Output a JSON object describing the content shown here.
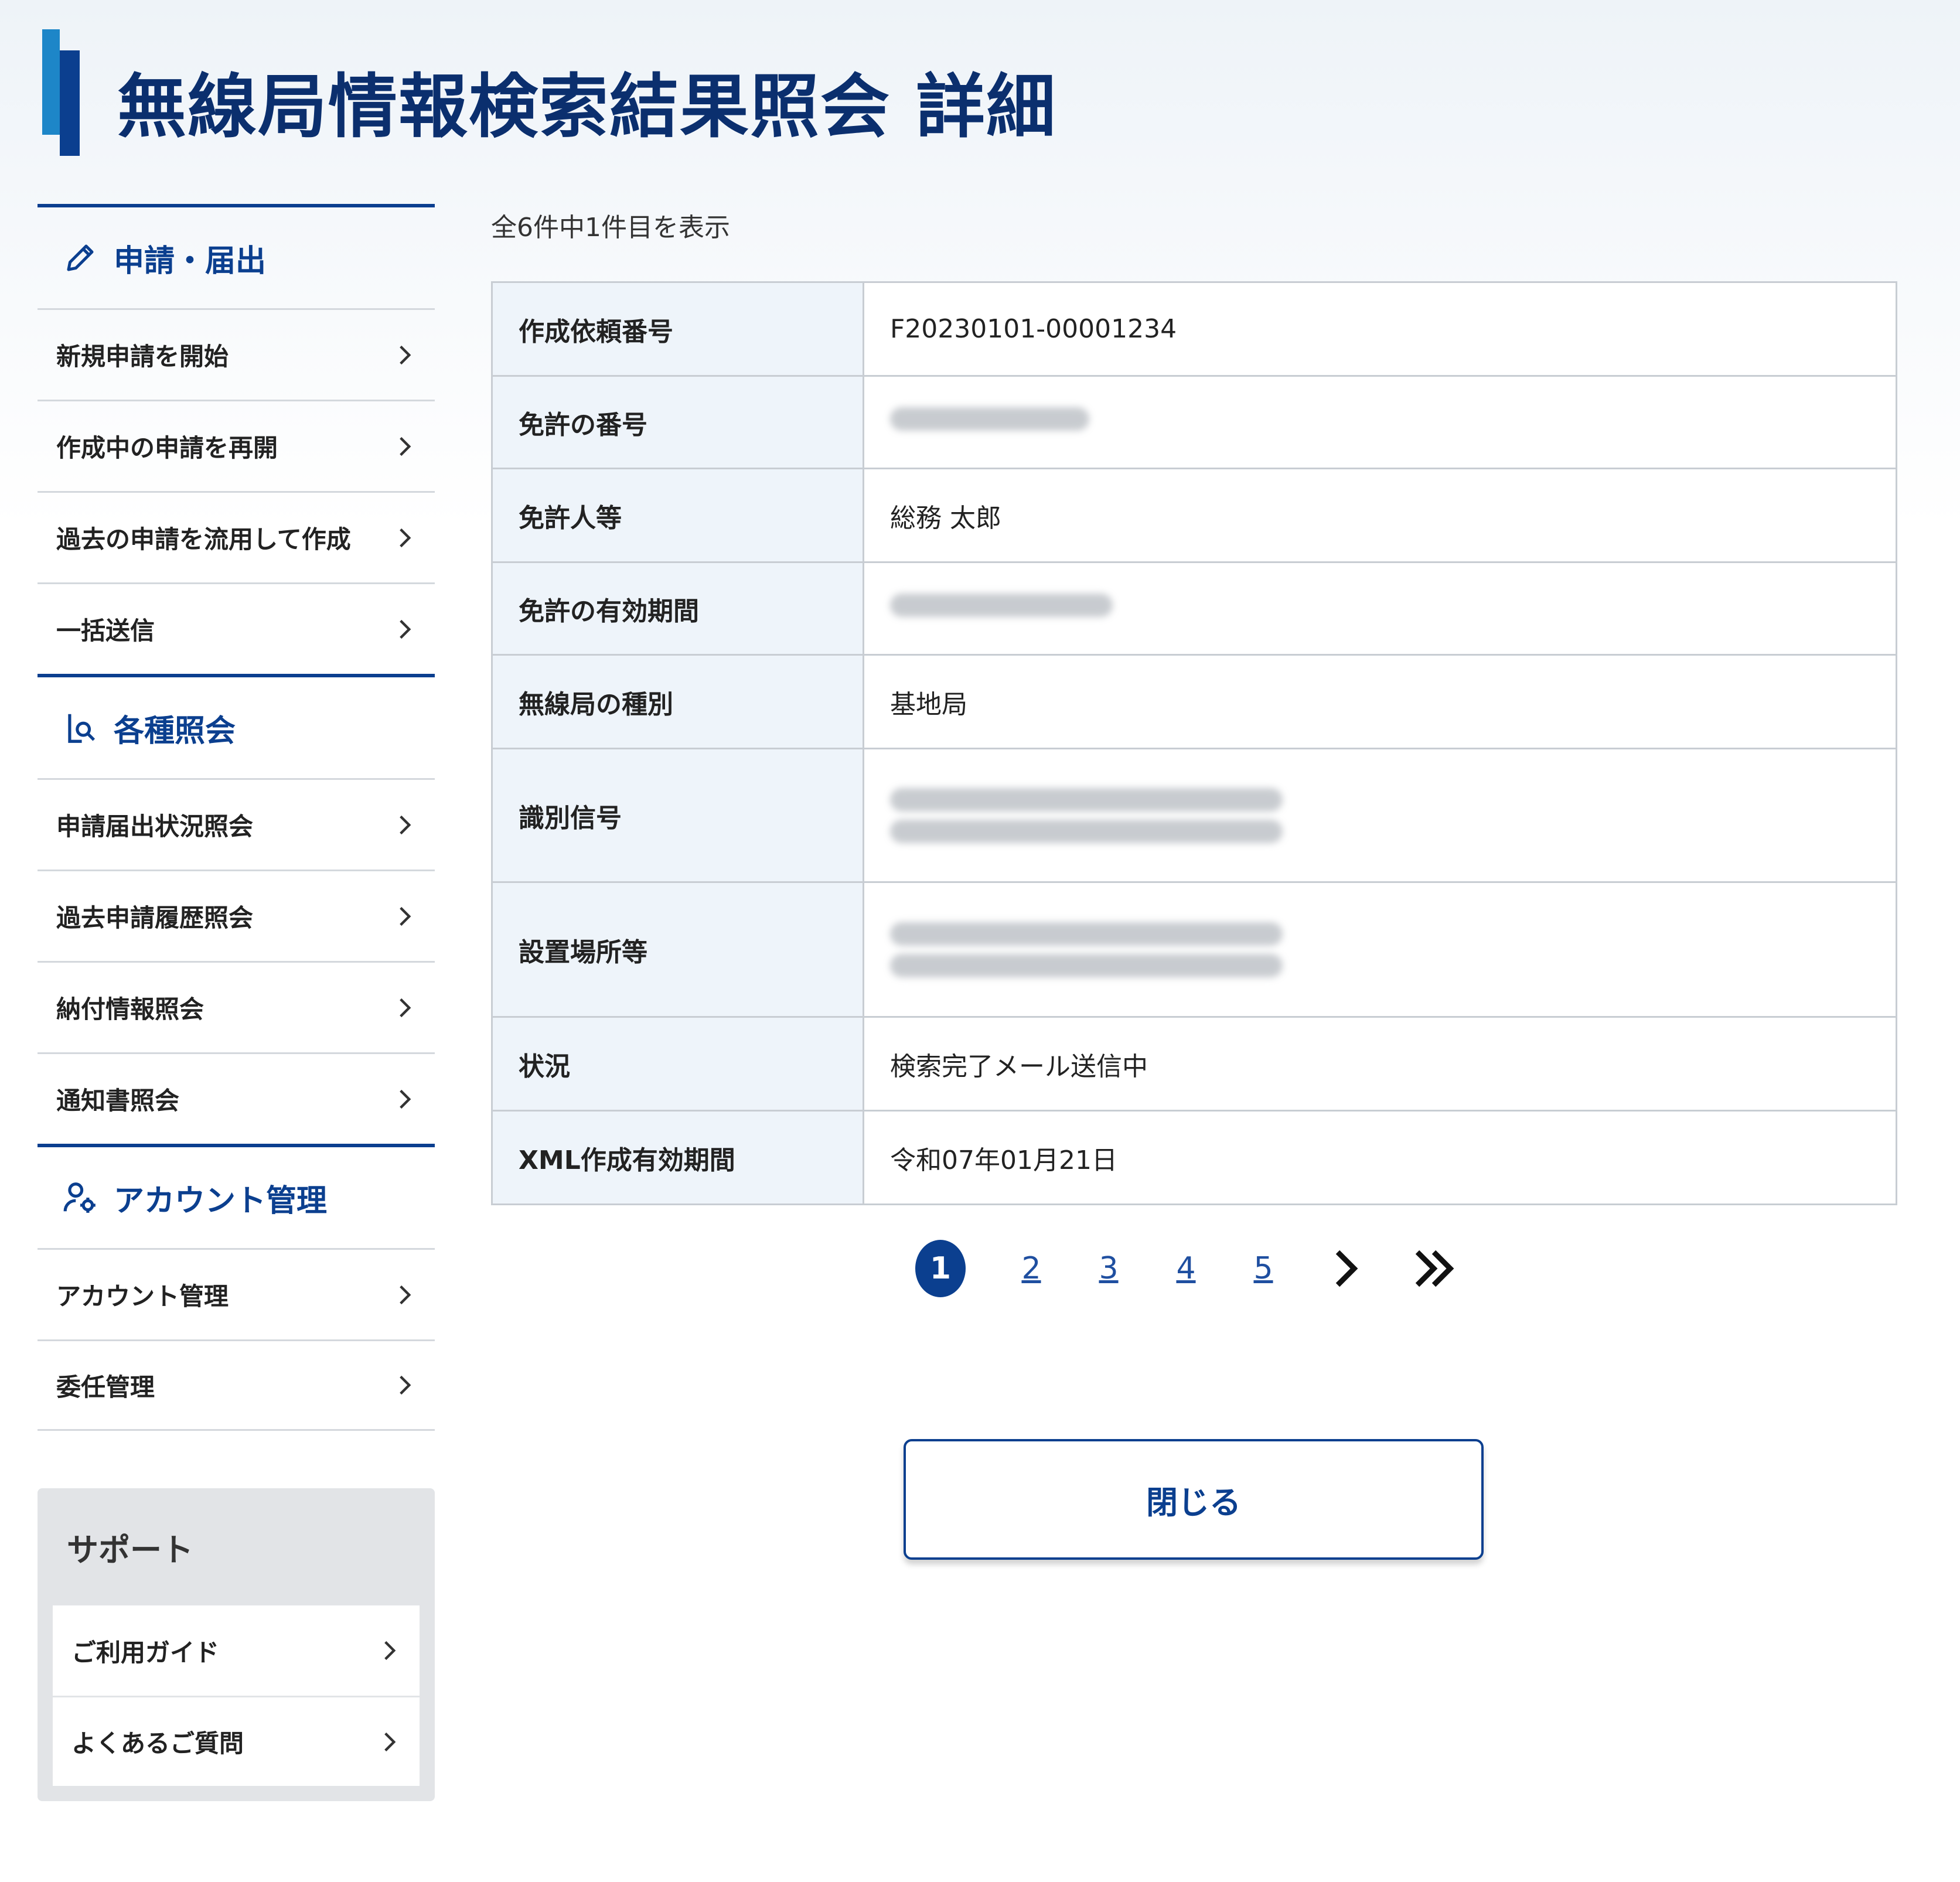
{
  "header": {
    "title": "無線局情報検索結果照会 詳細"
  },
  "sidebar": {
    "sections": [
      {
        "title": "申請・届出",
        "icon": "pencil-icon",
        "items": [
          "新規申請を開始",
          "作成中の申請を再開",
          "過去の申請を流用して作成",
          "一括送信"
        ]
      },
      {
        "title": "各種照会",
        "icon": "document-search-icon",
        "items": [
          "申請届出状況照会",
          "過去申請履歴照会",
          "納付情報照会",
          "通知書照会"
        ]
      },
      {
        "title": "アカウント管理",
        "icon": "user-gear-icon",
        "items": [
          "アカウント管理",
          "委任管理"
        ]
      }
    ],
    "support": {
      "title": "サポート",
      "items": [
        "ご利用ガイド",
        "よくあるご質問"
      ]
    }
  },
  "main": {
    "count_text": "全6件中1件目を表示",
    "rows": [
      {
        "label": "作成依頼番号",
        "value": "F20230101-00001234"
      },
      {
        "label": "免許の番号",
        "value": ""
      },
      {
        "label": "免許人等",
        "value": "総務 太郎"
      },
      {
        "label": "免許の有効期間",
        "value": ""
      },
      {
        "label": "無線局の種別",
        "value": "基地局"
      },
      {
        "label": "識別信号",
        "value": ""
      },
      {
        "label": "設置場所等",
        "value": ""
      },
      {
        "label": "状況",
        "value": "検索完了メール送信中"
      },
      {
        "label": "XML作成有効期間",
        "value": "令和07年01月21日"
      }
    ],
    "pagination": {
      "current": "1",
      "pages": [
        "2",
        "3",
        "4",
        "5"
      ]
    },
    "close_label": "閉じる"
  }
}
